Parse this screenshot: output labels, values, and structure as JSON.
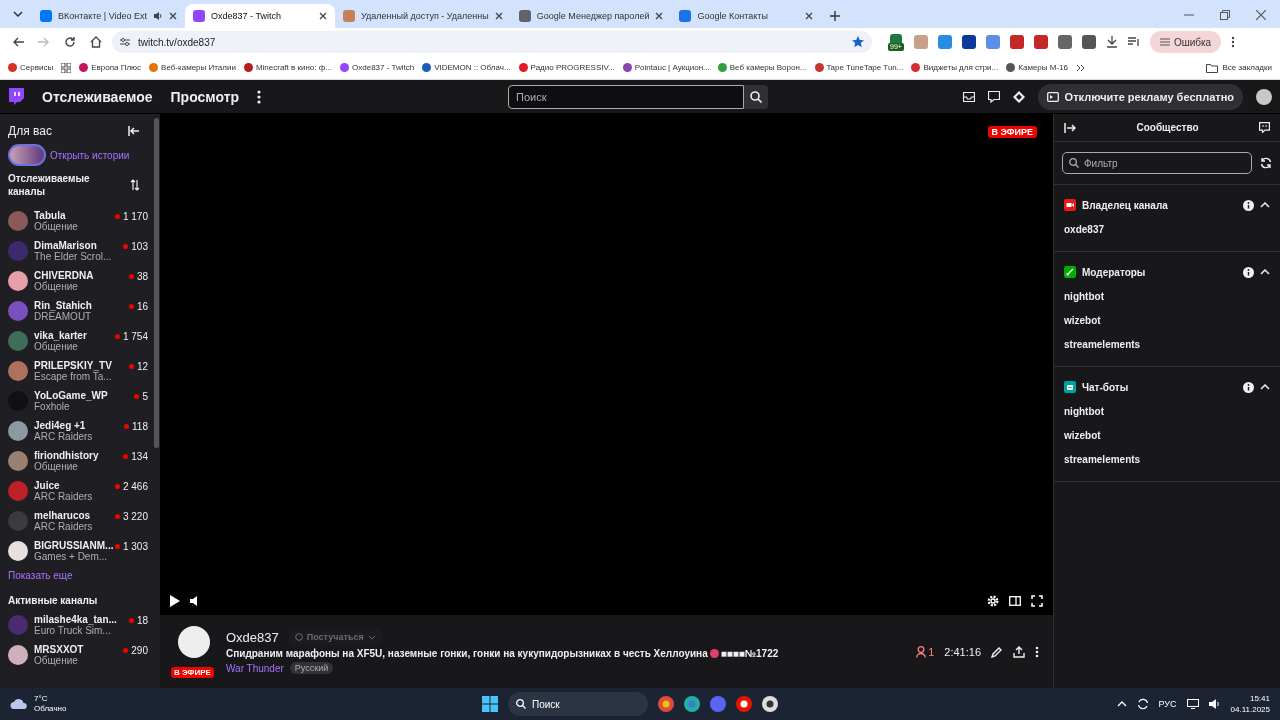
{
  "browser": {
    "tabs": [
      {
        "title": "ВКонтакте | Video Ext",
        "audio": true,
        "selected": false
      },
      {
        "title": "Oxde837 - Twitch",
        "audio": false,
        "selected": true
      },
      {
        "title": "Удаленный доступ - Удаленны",
        "audio": false,
        "selected": false
      },
      {
        "title": "Google Менеджер паролей",
        "audio": false,
        "selected": false
      },
      {
        "title": "Google Контакты",
        "audio": false,
        "selected": false
      }
    ],
    "address": "twitch.tv/oxde837",
    "bookmarked": true,
    "extension_badge": "99+",
    "error_button": "Ошибка",
    "bookmarks": [
      {
        "label": "Сервисы",
        "color": "#d93025"
      },
      {
        "label": "Европа Плюс",
        "color": "#c2185b"
      },
      {
        "label": "Веб-камеры Италии",
        "color": "#e8710a"
      },
      {
        "label": "Minecraft в кино: ф...",
        "color": "#b71c1c"
      },
      {
        "label": "Oxde837 - Twitch",
        "color": "#9146ff"
      },
      {
        "label": "VIDEMON :: Облач...",
        "color": "#1a5fb4"
      },
      {
        "label": "Радио PROGRESSIV...",
        "color": "#e01b24"
      },
      {
        "label": "Pointauc | Аукцион...",
        "color": "#8e44ad"
      },
      {
        "label": "Веб камеры Ворон...",
        "color": "#2e9e44"
      },
      {
        "label": "Tape TuneTape Tun...",
        "color": "#c0392b"
      },
      {
        "label": "Виджеты для стри...",
        "color": "#d32f2f"
      },
      {
        "label": "Камеры М-16",
        "color": "#555555"
      }
    ],
    "all_bookmarks": "Все закладки"
  },
  "topnav": {
    "links": [
      "Отслеживаемое",
      "Просмотр"
    ],
    "search_placeholder": "Поиск",
    "ad_button": "Отключите рекламу бесплатно"
  },
  "sidebar": {
    "heading": "Для вас",
    "stories": "Открыть истории",
    "followed_heading": "Отслеживаемые каналы",
    "channels": [
      {
        "name": "Tabula",
        "category": "Общение",
        "viewers": "1 170",
        "color": "#8a5a5a"
      },
      {
        "name": "DimaMarison",
        "category": "The Elder Scrol...",
        "viewers": "103",
        "color": "#3b2a6e"
      },
      {
        "name": "CHIVERDNA",
        "category": "Общение",
        "viewers": "38",
        "color": "#e8a0a8"
      },
      {
        "name": "Rin_Stahich",
        "category": "DREAMOUT",
        "viewers": "16",
        "color": "#7a4fc0"
      },
      {
        "name": "vika_karter",
        "category": "Общение",
        "viewers": "1 754",
        "color": "#3e6e5a"
      },
      {
        "name": "PRILEPSKIY_TV",
        "category": "Escape from Ta...",
        "viewers": "12",
        "color": "#b07060"
      },
      {
        "name": "YoLoGame_WP",
        "category": "Foxhole",
        "viewers": "5",
        "color": "#111111"
      },
      {
        "name": "Jedi4eg +1",
        "category": "ARC Raiders",
        "viewers": "118",
        "color": "#8a9aa0"
      },
      {
        "name": "firiondhistory",
        "category": "Общение",
        "viewers": "134",
        "color": "#9a8070"
      },
      {
        "name": "Juice",
        "category": "ARC Raiders",
        "viewers": "2 466",
        "color": "#c0202a"
      },
      {
        "name": "melharucos",
        "category": "ARC Raiders",
        "viewers": "3 220",
        "color": "#3a3a40"
      },
      {
        "name": "BIGRUSSIANM...",
        "category": "Games + Dem...",
        "viewers": "1 303",
        "color": "#e8e0e0"
      }
    ],
    "show_more": "Показать еще",
    "active_heading": "Активные каналы",
    "active_channels": [
      {
        "name": "milashe4ka_tan...",
        "category": "Euro Truck Sim...",
        "viewers": "18",
        "color": "#4a2a70"
      },
      {
        "name": "MRSXXOT",
        "category": "Общение",
        "viewers": "290",
        "color": "#d0b0b8"
      }
    ]
  },
  "player": {
    "live_badge": "В ЭФИРЕ"
  },
  "stream": {
    "channel": "Oxde837",
    "knock": "Постучаться",
    "knock_disabled": true,
    "title": "Спидраним марафоны на XF5U, наземные гонки, гонки на кукупидорызниках в честь Хеллоуина",
    "title_suffix": "■■■■№1722",
    "live": "В ЭФИРЕ",
    "game": "War Thunder",
    "tag": "Русский",
    "viewers": "1",
    "uptime": "2:41:16"
  },
  "community": {
    "title": "Сообщество",
    "filter_placeholder": "Фильтр",
    "groups": [
      {
        "kind": "owner",
        "title": "Владелец канала",
        "expanded": true,
        "members": [
          "oxde837"
        ]
      },
      {
        "kind": "moderators",
        "title": "Модераторы",
        "expanded": true,
        "members": [
          "nightbot",
          "wizebot",
          "streamelements"
        ]
      },
      {
        "kind": "bots",
        "title": "Чат-боты",
        "expanded": true,
        "members": [
          "nightbot",
          "wizebot",
          "streamelements"
        ]
      }
    ]
  },
  "taskbar": {
    "temperature": "7°C",
    "weather": "Облачно",
    "search": "Поиск",
    "language": "РУС",
    "time": "15:41",
    "date": "04.11.2025"
  }
}
